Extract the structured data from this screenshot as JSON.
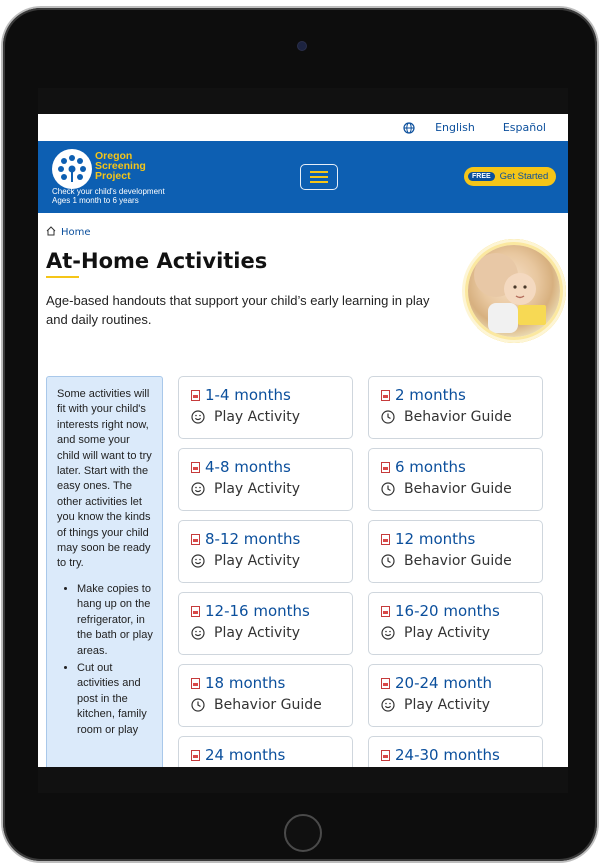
{
  "languages": [
    "English",
    "Español"
  ],
  "header": {
    "logo_lines": [
      "Oregon",
      "Screening",
      "Project"
    ],
    "tagline_lines": [
      "Check your child's development",
      "Ages 1 month to 6 years"
    ],
    "free_badge": "FREE",
    "cta_label": "Get Started"
  },
  "breadcrumb": {
    "home": "Home"
  },
  "page": {
    "title": "At-Home Activities",
    "intro": "Age-based handouts that support your child’s early learning in play and daily routines."
  },
  "sidebar": {
    "text": "Some activities will fit with your child's interests right now, and some your child will want to try later. Start with the easy ones. The other activities let you know the kinds of things your child may soon be ready to try.",
    "bullets": [
      "Make copies to hang up on the refrigerator, in the bath or play areas.",
      "Cut out activities and post in the kitchen, family room or play"
    ]
  },
  "cards": [
    {
      "label": "1-4 months",
      "type": "Play Activity",
      "icon": "smiley-icon"
    },
    {
      "label": "2 months",
      "type": "Behavior Guide",
      "icon": "clock-icon"
    },
    {
      "label": "4-8 months",
      "type": "Play Activity",
      "icon": "smiley-icon"
    },
    {
      "label": "6 months",
      "type": "Behavior Guide",
      "icon": "clock-icon"
    },
    {
      "label": "8-12 months",
      "type": "Play Activity",
      "icon": "smiley-icon"
    },
    {
      "label": "12 months",
      "type": "Behavior Guide",
      "icon": "clock-icon"
    },
    {
      "label": "12-16 months",
      "type": "Play Activity",
      "icon": "smiley-icon"
    },
    {
      "label": "16-20 months",
      "type": "Play Activity",
      "icon": "smiley-icon"
    },
    {
      "label": "18 months",
      "type": "Behavior Guide",
      "icon": "clock-icon"
    },
    {
      "label": "20-24 month",
      "type": "Play Activity",
      "icon": "smiley-icon"
    },
    {
      "label": "24 months",
      "type": "",
      "icon": ""
    },
    {
      "label": "24-30 months",
      "type": "",
      "icon": ""
    }
  ],
  "colors": {
    "brand_blue": "#0d5fb2",
    "accent_yellow": "#f5c518",
    "link_blue": "#0b4f9c",
    "sidebar_bg": "#dbeafa"
  }
}
